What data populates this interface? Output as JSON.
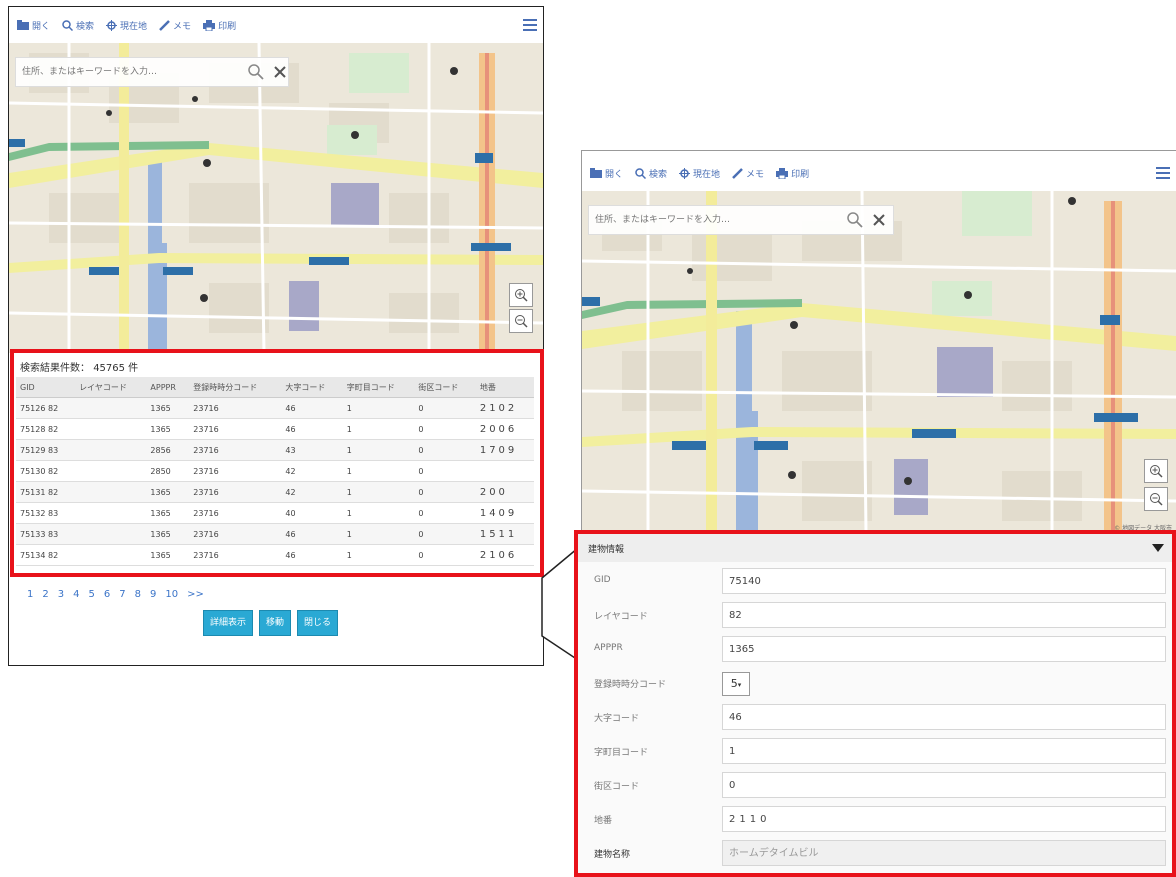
{
  "toolbar": {
    "items": [
      {
        "label": "開く",
        "icon": "folder-icon"
      },
      {
        "label": "検索",
        "icon": "search-icon"
      },
      {
        "label": "現在地",
        "icon": "location-icon"
      },
      {
        "label": "メモ",
        "icon": "pencil-icon"
      },
      {
        "label": "印刷",
        "icon": "print-icon"
      }
    ],
    "menu_icon": "hamburger-icon"
  },
  "search": {
    "placeholder": "住所、またはキーワードを入力…",
    "search_icon": "magnifier-icon",
    "clear_icon": "close-icon"
  },
  "map": {
    "zoom_in_icon": "zoom-in-icon",
    "zoom_out_icon": "zoom-out-icon",
    "attribution": "© 地図データ 大阪市"
  },
  "results": {
    "count_label": "検索結果件数：",
    "count_value": "45765 件",
    "columns": [
      "GID",
      "レイヤコード",
      "APPPR",
      "登録時時分コード",
      "大字コード",
      "字町目コード",
      "街区コード",
      "地番"
    ],
    "rows": [
      [
        "75126 82",
        "1365",
        "23716",
        "46",
        "1",
        "0",
        "2102"
      ],
      [
        "75128 82",
        "1365",
        "23716",
        "46",
        "1",
        "0",
        "2006"
      ],
      [
        "75129 83",
        "2856",
        "23716",
        "43",
        "1",
        "0",
        "1709"
      ],
      [
        "75130 82",
        "2850",
        "23716",
        "42",
        "1",
        "0",
        ""
      ],
      [
        "75131 82",
        "1365",
        "23716",
        "42",
        "1",
        "0",
        "200"
      ],
      [
        "75132 83",
        "1365",
        "23716",
        "40",
        "1",
        "0",
        "1409"
      ],
      [
        "75133 83",
        "1365",
        "23716",
        "46",
        "1",
        "0",
        "1511"
      ],
      [
        "75134 82",
        "1365",
        "23716",
        "46",
        "1",
        "0",
        "2106"
      ]
    ],
    "pages": [
      "1",
      "2",
      "3",
      "4",
      "5",
      "6",
      "7",
      "8",
      "9",
      "10",
      ">>"
    ],
    "buttons": [
      "詳細表示",
      "移動",
      "閉じる"
    ]
  },
  "detail": {
    "header": "建物情報",
    "fields": [
      {
        "label": "GID",
        "value": "75140"
      },
      {
        "label": "レイヤコード",
        "value": "82"
      },
      {
        "label": "APPPR",
        "value": "1365"
      },
      {
        "label": "登録時時分コード",
        "value": "5"
      },
      {
        "label": "大字コード",
        "value": "46"
      },
      {
        "label": "字町目コード",
        "value": "1"
      },
      {
        "label": "街区コード",
        "value": "0"
      },
      {
        "label": "地番",
        "value": "2110"
      },
      {
        "label": "建物名称",
        "value": "ホームデタイムビル"
      }
    ]
  },
  "colors": {
    "highlight": "#e8121a",
    "link": "#3b74c8",
    "button": "#2aa9d4",
    "toolbar_icon": "#4a6fb5"
  }
}
